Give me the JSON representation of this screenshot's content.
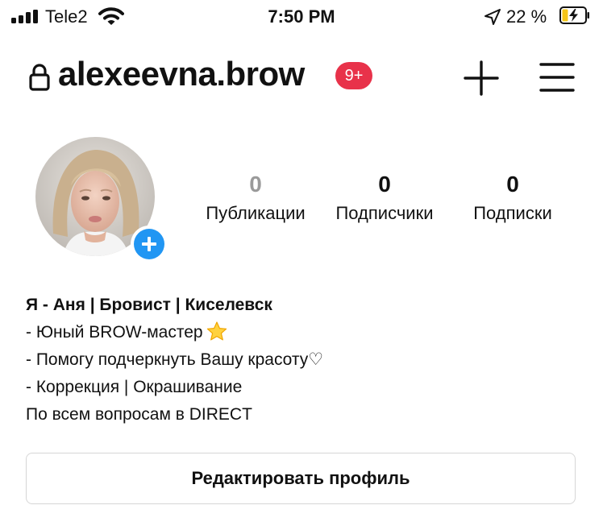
{
  "status_bar": {
    "carrier": "Tele2",
    "time": "7:50 PM",
    "battery": "22 %",
    "icons": [
      "signal-icon",
      "wifi-icon",
      "location-arrow-icon",
      "battery-charging-icon"
    ]
  },
  "header": {
    "username": "alexeevna.brow",
    "notification_count": "9+",
    "icons": [
      "lock-icon",
      "plus-icon",
      "menu-icon"
    ],
    "badge_color": "#e8324a"
  },
  "stats": [
    {
      "value": "0",
      "label": "Публикации"
    },
    {
      "value": "0",
      "label": "Подписчики"
    },
    {
      "value": "0",
      "label": "Подписки"
    }
  ],
  "bio": {
    "name": "Я - Аня | Бровист | Киселевск",
    "lines": [
      "- Юный BROW-мастер",
      "- Помогу подчеркнуть Вашу красоту♡",
      "- Коррекция | Окрашивание",
      "По всем вопросам в DIRECT"
    ]
  },
  "edit_button": "Редактировать профиль",
  "accent_color": "#2196f3"
}
